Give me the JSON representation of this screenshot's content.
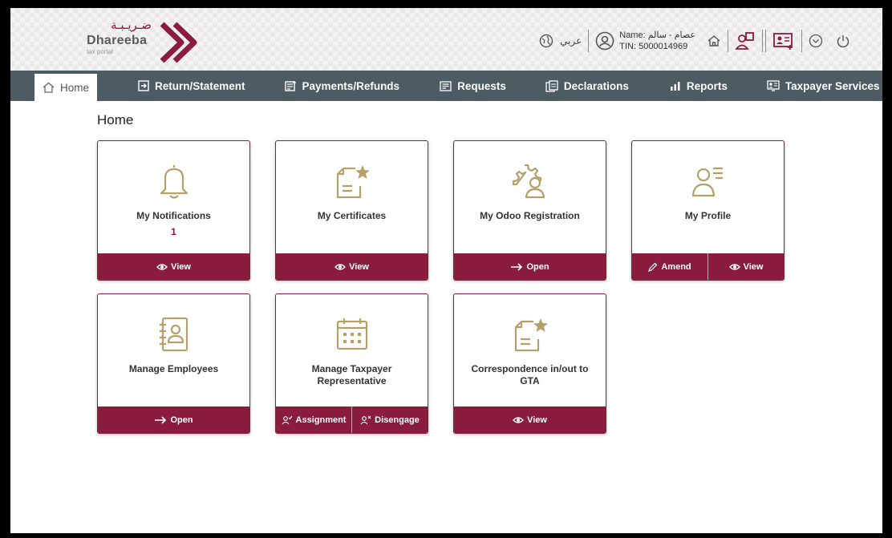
{
  "header": {
    "logo_arabic": "ضـريـبـة",
    "logo_name": "Dhareeba",
    "logo_sub": "tax portal",
    "language_label": "عربي",
    "user_name": "Name: عصام - سالم",
    "user_tin": "TIN: 5000014969",
    "icons": [
      "globe-icon",
      "user-circle-icon",
      "home-icon",
      "user-switch-icon",
      "id-card-icon",
      "chevron-down-circle-icon",
      "power-icon"
    ]
  },
  "nav": {
    "items": [
      {
        "label": "Home",
        "icon": "home-icon"
      },
      {
        "label": "Return/Statement",
        "icon": "return-icon"
      },
      {
        "label": "Payments/Refunds",
        "icon": "payments-icon"
      },
      {
        "label": "Requests",
        "icon": "requests-icon"
      },
      {
        "label": "Declarations",
        "icon": "declarations-icon"
      },
      {
        "label": "Reports",
        "icon": "reports-icon"
      },
      {
        "label": "Taxpayer Services",
        "icon": "taxpayer-services-icon"
      }
    ]
  },
  "page_title": "Home",
  "cards": {
    "notifications": {
      "title": "My Notifications",
      "count": "1",
      "action": "View",
      "icon": "bell-icon"
    },
    "certificates": {
      "title": "My Certificates",
      "action": "View",
      "icon": "certificate-icon"
    },
    "odoo": {
      "title": "My Odoo Registration",
      "action": "Open",
      "icon": "gear-user-icon"
    },
    "profile": {
      "title": "My Profile",
      "action_amend": "Amend",
      "action_view": "View",
      "icon": "profile-icon"
    },
    "employees": {
      "title": "Manage Employees",
      "action": "Open",
      "icon": "address-book-icon"
    },
    "representative": {
      "title": "Manage Taxpayer Representative",
      "action_assign": "Assignment",
      "action_disengage": "Disengage",
      "icon": "calendar-icon"
    },
    "correspondence": {
      "title": "Correspondence in/out to GTA",
      "action": "View",
      "icon": "document-star-icon"
    }
  },
  "colors": {
    "brand": "#8a1c3d",
    "nav": "#4d5b63",
    "icon_gold": "#b5a06a"
  }
}
